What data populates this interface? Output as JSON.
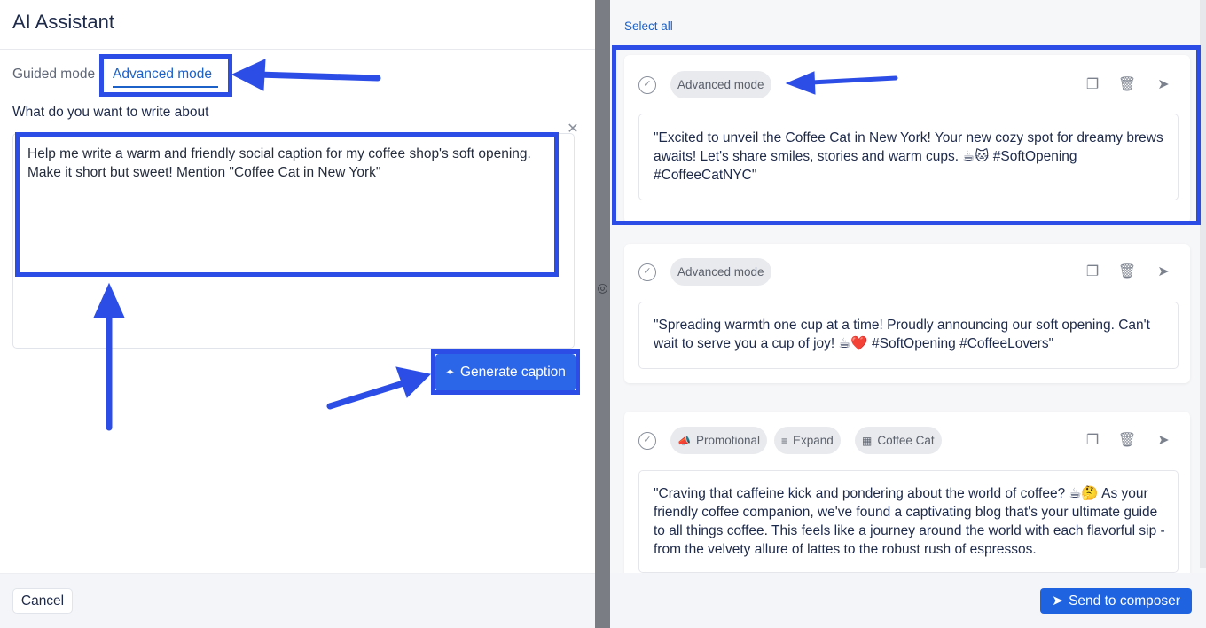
{
  "left_panel": {
    "title": "AI Assistant",
    "tabs": [
      {
        "label": "Guided mode"
      },
      {
        "label": "Advanced mode",
        "active": true
      }
    ],
    "question_label": "What do you want to write about",
    "prompt_text": "Help me write a warm and friendly social caption for my coffee shop's soft opening. Make it short but sweet! Mention \"Coffee Cat in New York\"",
    "close_icon": "close-icon",
    "generate_button": "Generate caption",
    "cancel_button": "Cancel"
  },
  "right_panel": {
    "select_all": "Select all",
    "cards": [
      {
        "tags": [
          "Advanced mode"
        ],
        "caption": "\"Excited to unveil the Coffee Cat in New York! Your new cozy spot for dreamy brews awaits! Let's share smiles, stories and warm cups. ☕🐱 #SoftOpening #CoffeeCatNYC\""
      },
      {
        "tags": [
          "Advanced mode"
        ],
        "caption": "\"Spreading warmth one cup at a time! Proudly announcing our soft opening. Can't wait to serve you a cup of joy! ☕❤️ #SoftOpening #CoffeeLovers\""
      },
      {
        "tags": [
          "Promotional",
          "Expand",
          "Coffee Cat"
        ],
        "tag_icons": [
          "megaphone-icon",
          "lines-icon",
          "building-icon"
        ],
        "caption": "\"Craving that caffeine kick and pondering about the world of coffee? ☕🤔 As your friendly coffee companion, we've found a captivating blog that's your ultimate guide to all things coffee. This feels like a journey around the world with each flavorful sip - from the velvety allure of lattes to the robust rush of espressos."
      }
    ],
    "send_button": "Send to composer"
  },
  "colors": {
    "accent": "#1c61c7",
    "button_blue": "#2b66e8",
    "annotation_blue": "#2d4ee6"
  }
}
